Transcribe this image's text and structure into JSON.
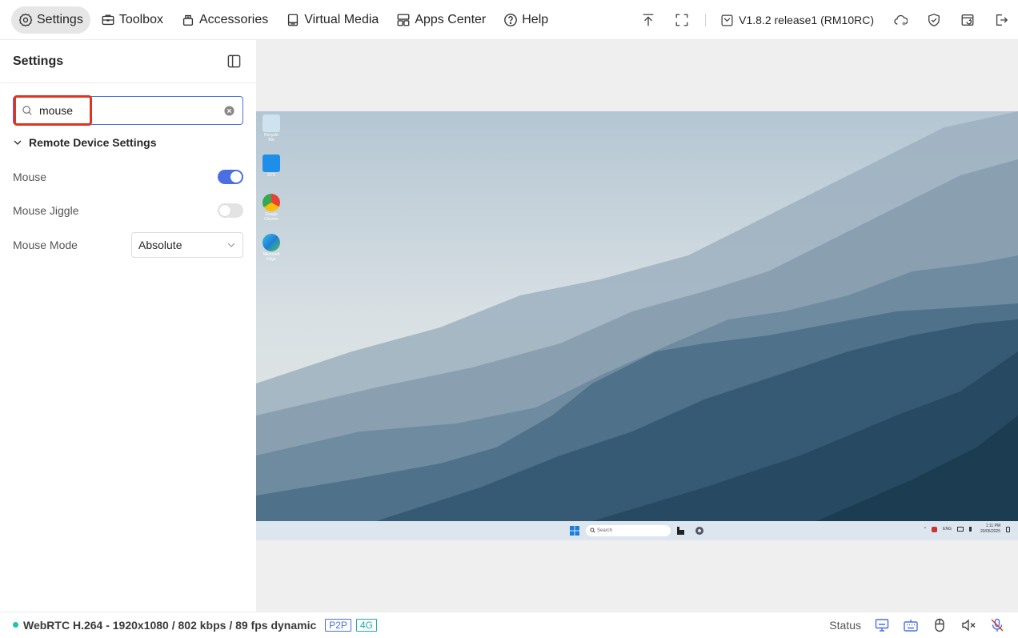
{
  "nav": {
    "items": [
      {
        "label": "Settings",
        "icon": "gear-icon",
        "active": true
      },
      {
        "label": "Toolbox",
        "icon": "toolbox-icon"
      },
      {
        "label": "Accessories",
        "icon": "accessories-icon"
      },
      {
        "label": "Virtual Media",
        "icon": "drive-icon"
      },
      {
        "label": "Apps Center",
        "icon": "apps-icon"
      },
      {
        "label": "Help",
        "icon": "help-icon"
      }
    ]
  },
  "topbar": {
    "version": "V1.8.2 release1 (RM10RC)"
  },
  "sidebar": {
    "title": "Settings",
    "search": {
      "value": "mouse",
      "placeholder": ""
    },
    "group_label": "Remote Device Settings",
    "mouse": {
      "label": "Mouse",
      "enabled": true
    },
    "mouse_jiggle": {
      "label": "Mouse Jiggle",
      "enabled": false
    },
    "mouse_mode": {
      "label": "Mouse Mode",
      "value": "Absolute"
    }
  },
  "desktop": {
    "icons": [
      {
        "label": "Recycle Bin"
      },
      {
        "label": "SYS"
      },
      {
        "label": "Google Chrome"
      },
      {
        "label": "Microsoft Edge"
      }
    ],
    "taskbar": {
      "search_placeholder": "Search",
      "lang": "ENG",
      "time": "1:11 PM",
      "date": "20/05/2025"
    }
  },
  "status": {
    "stream_info": "WebRTC H.264 - 1920x1080 / 802 kbps / 89 fps dynamic",
    "p2p": "P2P",
    "net": "4G",
    "status_label": "Status"
  },
  "colors": {
    "accent": "#4a6fe3",
    "connection": "#1ec7a0",
    "highlight": "#e2331f"
  }
}
